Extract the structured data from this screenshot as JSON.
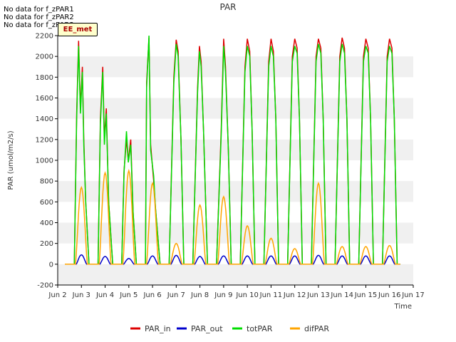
{
  "no_data_notes": [
    "No data for f_zPAR1",
    "No data for f_zPAR2",
    "No data for f_zPAR3"
  ],
  "site_badge": "EE_met",
  "chart_data": {
    "type": "line",
    "title": "PAR",
    "xlabel": "Time",
    "ylabel": "PAR (umol/m2/s)",
    "ylim": [
      -200,
      2200
    ],
    "xlim": [
      2,
      17
    ],
    "x_unit": "day of June",
    "yticks": [
      -200,
      0,
      200,
      400,
      600,
      800,
      1000,
      1200,
      1400,
      1600,
      1800,
      2000,
      2200
    ],
    "xtick_labels": [
      "Jun 2",
      "Jun 3",
      "Jun 4",
      "Jun 5",
      "Jun 6",
      "Jun 7",
      "Jun 8",
      "Jun 9",
      "Jun 10",
      "Jun 11",
      "Jun 12",
      "Jun 13",
      "Jun 14",
      "Jun 15",
      "Jun 16",
      "Jun 17"
    ],
    "grid": "horizontal bands",
    "legend": "bottom",
    "series": [
      {
        "name": "PAR_in",
        "color": "#dd0000",
        "days": [
          [
            2.8,
            1450
          ],
          [
            2.88,
            2150
          ],
          [
            2.96,
            1500
          ],
          [
            3.04,
            1900
          ],
          [
            3.1,
            1200
          ],
          [
            3.18,
            600
          ],
          [
            3.8,
            1400
          ],
          [
            3.9,
            1900
          ],
          [
            3.97,
            1200
          ],
          [
            4.05,
            1500
          ],
          [
            4.15,
            600
          ],
          [
            4.8,
            900
          ],
          [
            4.9,
            1200
          ],
          [
            4.98,
            1000
          ],
          [
            5.08,
            1200
          ],
          [
            5.18,
            500
          ],
          [
            5.75,
            1750
          ],
          [
            5.85,
            2180
          ],
          [
            5.92,
            1150
          ],
          [
            6.05,
            800
          ],
          [
            6.12,
            550
          ],
          [
            6.9,
            1800
          ],
          [
            7.0,
            2160
          ],
          [
            7.08,
            2050
          ],
          [
            7.2,
            1200
          ],
          [
            7.9,
            1700
          ],
          [
            7.98,
            2100
          ],
          [
            8.05,
            1950
          ],
          [
            8.15,
            1300
          ],
          [
            8.9,
            1300
          ],
          [
            9.0,
            2170
          ],
          [
            9.08,
            1900
          ],
          [
            9.2,
            1100
          ],
          [
            9.9,
            1900
          ],
          [
            10.0,
            2170
          ],
          [
            10.1,
            2050
          ],
          [
            10.2,
            1300
          ],
          [
            10.9,
            1950
          ],
          [
            11.0,
            2170
          ],
          [
            11.1,
            2050
          ],
          [
            11.2,
            1400
          ],
          [
            11.9,
            2000
          ],
          [
            12.0,
            2170
          ],
          [
            12.1,
            2080
          ],
          [
            12.2,
            1400
          ],
          [
            12.9,
            2000
          ],
          [
            13.0,
            2170
          ],
          [
            13.1,
            2080
          ],
          [
            13.2,
            1400
          ],
          [
            13.9,
            2000
          ],
          [
            14.0,
            2180
          ],
          [
            14.1,
            2080
          ],
          [
            14.2,
            1400
          ],
          [
            14.9,
            2000
          ],
          [
            15.0,
            2170
          ],
          [
            15.1,
            2080
          ],
          [
            15.2,
            1400
          ],
          [
            15.9,
            2000
          ],
          [
            16.0,
            2170
          ],
          [
            16.1,
            2080
          ],
          [
            16.2,
            1400
          ]
        ]
      },
      {
        "name": "PAR_out",
        "color": "#0000cc",
        "peaks": [
          [
            3.0,
            90
          ],
          [
            4.0,
            75
          ],
          [
            5.0,
            55
          ],
          [
            6.0,
            80
          ],
          [
            7.0,
            85
          ],
          [
            8.0,
            75
          ],
          [
            9.0,
            80
          ],
          [
            10.0,
            80
          ],
          [
            11.0,
            80
          ],
          [
            12.0,
            80
          ],
          [
            13.0,
            85
          ],
          [
            14.0,
            80
          ],
          [
            15.0,
            80
          ],
          [
            16.0,
            80
          ]
        ]
      },
      {
        "name": "totPAR",
        "color": "#00dd00",
        "days": [
          [
            2.8,
            1400
          ],
          [
            2.88,
            2100
          ],
          [
            2.96,
            1450
          ],
          [
            3.04,
            1850
          ],
          [
            3.1,
            1150
          ],
          [
            3.18,
            600
          ],
          [
            3.8,
            1350
          ],
          [
            3.9,
            1850
          ],
          [
            3.97,
            1150
          ],
          [
            4.05,
            1450
          ],
          [
            4.15,
            600
          ],
          [
            4.8,
            880
          ],
          [
            4.9,
            1280
          ],
          [
            4.98,
            980
          ],
          [
            5.08,
            1150
          ],
          [
            5.18,
            500
          ],
          [
            5.75,
            1700
          ],
          [
            5.85,
            2200
          ],
          [
            5.92,
            1100
          ],
          [
            6.05,
            850
          ],
          [
            6.12,
            550
          ],
          [
            6.9,
            1750
          ],
          [
            7.0,
            2120
          ],
          [
            7.08,
            2000
          ],
          [
            7.2,
            1200
          ],
          [
            7.9,
            1650
          ],
          [
            7.98,
            2050
          ],
          [
            8.05,
            1900
          ],
          [
            8.15,
            1300
          ],
          [
            8.9,
            1250
          ],
          [
            9.0,
            2100
          ],
          [
            9.08,
            1850
          ],
          [
            9.2,
            1100
          ],
          [
            9.9,
            1850
          ],
          [
            10.0,
            2100
          ],
          [
            10.1,
            2000
          ],
          [
            10.2,
            1300
          ],
          [
            10.9,
            1900
          ],
          [
            11.0,
            2100
          ],
          [
            11.1,
            2000
          ],
          [
            11.2,
            1400
          ],
          [
            11.9,
            1950
          ],
          [
            12.0,
            2100
          ],
          [
            12.1,
            2030
          ],
          [
            12.2,
            1400
          ],
          [
            12.9,
            1950
          ],
          [
            13.0,
            2120
          ],
          [
            13.1,
            2030
          ],
          [
            13.2,
            1400
          ],
          [
            13.9,
            1950
          ],
          [
            14.0,
            2120
          ],
          [
            14.1,
            2030
          ],
          [
            14.2,
            1400
          ],
          [
            14.9,
            1950
          ],
          [
            15.0,
            2100
          ],
          [
            15.1,
            2030
          ],
          [
            15.2,
            1400
          ],
          [
            15.9,
            1950
          ],
          [
            16.0,
            2100
          ],
          [
            16.1,
            2030
          ],
          [
            16.2,
            1400
          ]
        ]
      },
      {
        "name": "difPAR",
        "color": "#ffa500",
        "peaks": [
          [
            3.0,
            740
          ],
          [
            4.0,
            880
          ],
          [
            5.0,
            900
          ],
          [
            6.0,
            780
          ],
          [
            7.0,
            200
          ],
          [
            8.0,
            570
          ],
          [
            9.0,
            650
          ],
          [
            10.0,
            370
          ],
          [
            11.0,
            250
          ],
          [
            12.0,
            150
          ],
          [
            13.0,
            780
          ],
          [
            14.0,
            170
          ],
          [
            15.0,
            170
          ],
          [
            16.0,
            180
          ]
        ]
      }
    ]
  }
}
